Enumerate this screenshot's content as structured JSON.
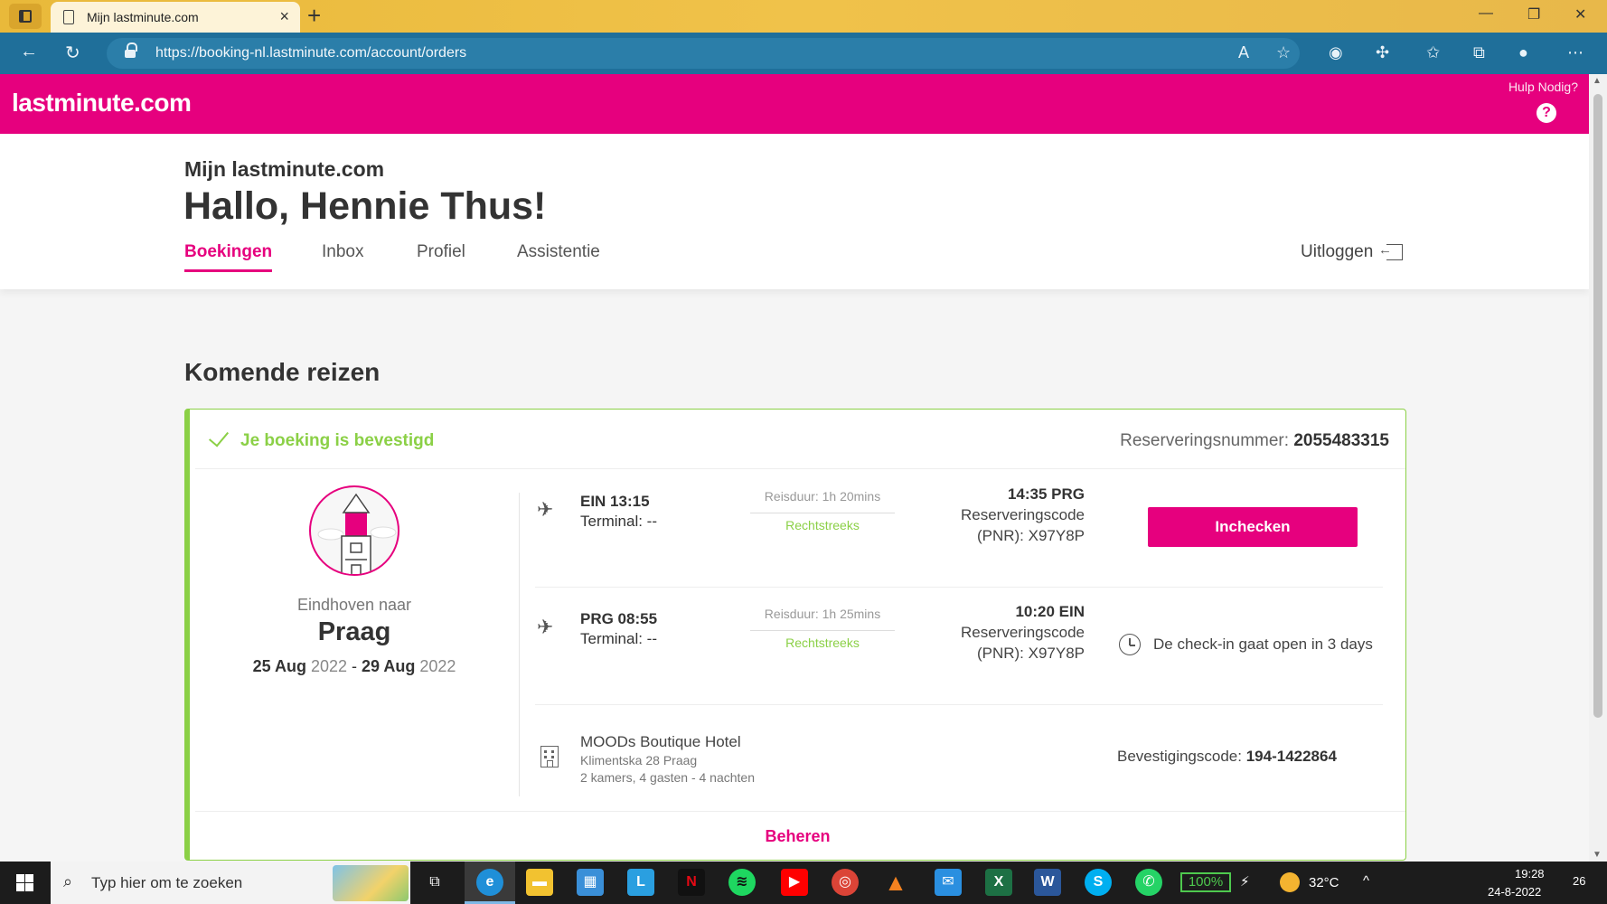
{
  "browser": {
    "tab_title": "Mijn lastminute.com",
    "url": "https://booking-nl.lastminute.com/account/orders"
  },
  "site": {
    "logo": "lastminute.com",
    "help_label": "Hulp Nodig?",
    "help_icon": "?"
  },
  "account": {
    "subtitle": "Mijn lastminute.com",
    "greeting": "Hallo, Hennie Thus!",
    "tabs": [
      {
        "label": "Boekingen",
        "active": true
      },
      {
        "label": "Inbox",
        "active": false
      },
      {
        "label": "Profiel",
        "active": false
      },
      {
        "label": "Assistentie",
        "active": false
      }
    ],
    "logout_label": "Uitloggen"
  },
  "section_title": "Komende reizen",
  "booking": {
    "status": "Je boeking is bevestigd",
    "reservation_label": "Reserveringsnummer:",
    "reservation_number": "2055483315",
    "from_text": "Eindhoven naar",
    "city": "Praag",
    "date_start_day": "25 Aug",
    "date_start_year": "2022",
    "date_sep": " - ",
    "date_end_day": "29 Aug",
    "date_end_year": "2022",
    "flights": [
      {
        "dep_airport_time": "EIN 13:15",
        "terminal": "Terminal: --",
        "duration": "Reisduur: 1h 20mins",
        "direct": "Rechtstreeks",
        "arr_time_airport": "14:35 PRG",
        "code_label": "Reserveringscode",
        "pnr": "(PNR): X97Y8P"
      },
      {
        "dep_airport_time": "PRG 08:55",
        "terminal": "Terminal: --",
        "duration": "Reisduur: 1h 25mins",
        "direct": "Rechtstreeks",
        "arr_time_airport": "10:20 EIN",
        "code_label": "Reserveringscode",
        "pnr": "(PNR): X97Y8P"
      }
    ],
    "checkin_button": "Inchecken",
    "checkin_note": "De check-in gaat open in 3 days",
    "hotel": {
      "name": "MOODs Boutique Hotel",
      "address": "Klimentska 28 Praag",
      "details": "2 kamers, 4 gasten - 4 nachten",
      "confirmation_label": "Bevestigingscode:",
      "confirmation_code": "194-1422864"
    },
    "manage_link": "Beheren"
  },
  "taskbar": {
    "search_placeholder": "Typ hier om te zoeken",
    "battery": "100%",
    "temperature": "32°C",
    "time": "19:28",
    "date": "24-8-2022",
    "notifications": "26"
  },
  "colors": {
    "brand": "#e6007e",
    "success": "#8bd046",
    "browser_bar": "#1f6f9a",
    "tab_strip": "#f0c24a"
  }
}
